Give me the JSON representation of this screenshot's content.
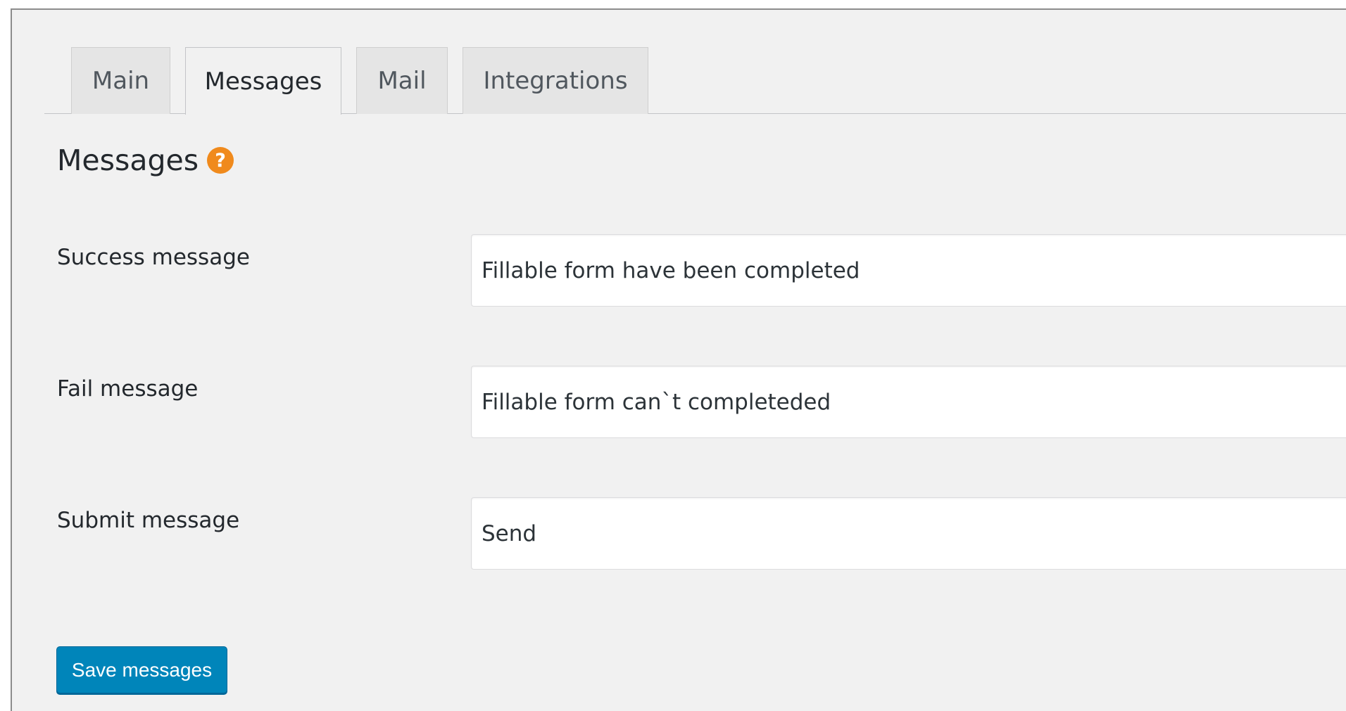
{
  "tabs": [
    {
      "label": "Main",
      "active": false
    },
    {
      "label": "Messages",
      "active": true
    },
    {
      "label": "Mail",
      "active": false
    },
    {
      "label": "Integrations",
      "active": false
    }
  ],
  "section": {
    "title": "Messages",
    "help_icon": "help-icon",
    "help_glyph": "?"
  },
  "fields": {
    "success": {
      "label": "Success message",
      "value": "Fillable form have been completed"
    },
    "fail": {
      "label": "Fail message",
      "value": "Fillable form can`t completeded"
    },
    "submit": {
      "label": "Submit message",
      "value": "Send"
    }
  },
  "save_button": {
    "label": "Save messages"
  },
  "colors": {
    "accent": "#0085ba",
    "help_icon": "#f08a1c",
    "background": "#f1f1f1"
  }
}
